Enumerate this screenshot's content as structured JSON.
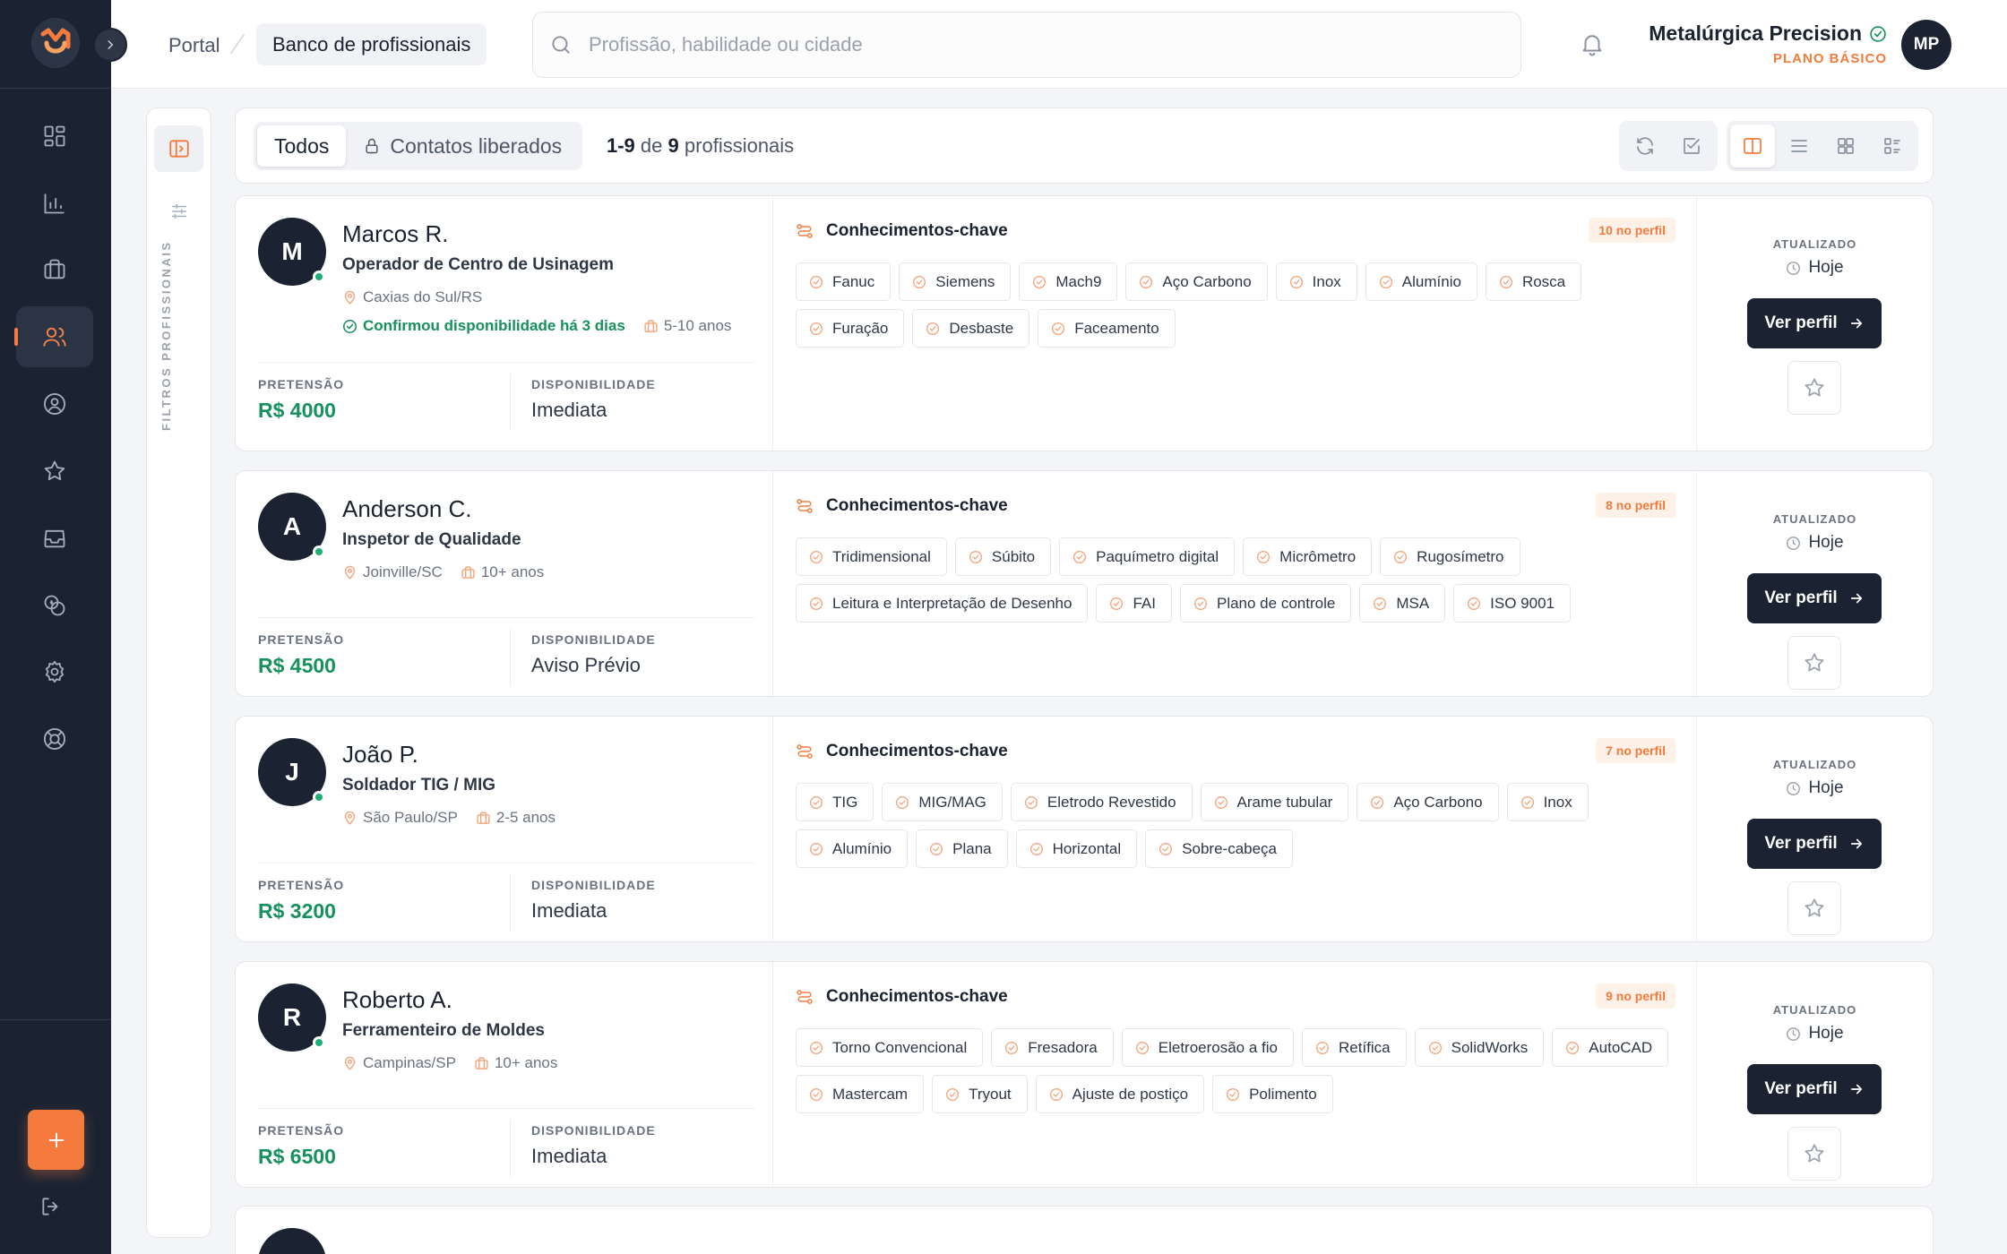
{
  "header": {
    "breadcrumb_root": "Portal",
    "breadcrumb_current": "Banco de profissionais",
    "search_placeholder": "Profissão, habilidade ou cidade",
    "company_name": "Metalúrgica Precision",
    "company_plan": "PLANO BÁSICO",
    "avatar_initials": "MP"
  },
  "filters": {
    "label": "FILTROS PROFISSIONAIS"
  },
  "toolbar": {
    "tab_all": "Todos",
    "tab_unlocked": "Contatos liberados",
    "count_range": "1-9",
    "count_of": "de",
    "count_total": "9",
    "count_suffix": "profissionais"
  },
  "labels": {
    "key_knowledge": "Conhecimentos-chave",
    "salary": "PRETENSÃO",
    "availability": "DISPONIBILIDADE",
    "updated": "ATUALIZADO",
    "view_profile": "Ver perfil"
  },
  "professionals": [
    {
      "initial": "M",
      "name": "Marcos R.",
      "role": "Operador de Centro de Usinagem",
      "city": "Caxias do Sul/RS",
      "availability_confirmed": "Confirmou disponibilidade há 3 dias",
      "experience": "5-10 anos",
      "salary": "R$ 4000",
      "availability": "Imediata",
      "skills_count": "10 no perfil",
      "updated": "Hoje",
      "skills": [
        "Fanuc",
        "Siemens",
        "Mach9",
        "Aço Carbono",
        "Inox",
        "Alumínio",
        "Rosca",
        "Furação",
        "Desbaste",
        "Faceamento"
      ]
    },
    {
      "initial": "A",
      "name": "Anderson C.",
      "role": "Inspetor de Qualidade",
      "city": "Joinville/SC",
      "experience": "10+ anos",
      "salary": "R$ 4500",
      "availability": "Aviso Prévio",
      "skills_count": "8 no perfil",
      "updated": "Hoje",
      "skills": [
        "Tridimensional",
        "Súbito",
        "Paquímetro digital",
        "Micrômetro",
        "Rugosímetro",
        "Leitura e Interpretação de Desenho",
        "FAI",
        "Plano de controle",
        "MSA",
        "ISO 9001"
      ]
    },
    {
      "initial": "J",
      "name": "João P.",
      "role": "Soldador TIG / MIG",
      "city": "São Paulo/SP",
      "experience": "2-5 anos",
      "salary": "R$ 3200",
      "availability": "Imediata",
      "skills_count": "7 no perfil",
      "updated": "Hoje",
      "skills": [
        "TIG",
        "MIG/MAG",
        "Eletrodo Revestido",
        "Arame tubular",
        "Aço Carbono",
        "Inox",
        "Alumínio",
        "Plana",
        "Horizontal",
        "Sobre-cabeça"
      ]
    },
    {
      "initial": "R",
      "name": "Roberto A.",
      "role": "Ferramenteiro de Moldes",
      "city": "Campinas/SP",
      "experience": "10+ anos",
      "salary": "R$ 6500",
      "availability": "Imediata",
      "skills_count": "9 no perfil",
      "updated": "Hoje",
      "skills": [
        "Torno Convencional",
        "Fresadora",
        "Eletroerosão a fio",
        "Retífica",
        "SolidWorks",
        "AutoCAD",
        "Mastercam",
        "Tryout",
        "Ajuste de postiço",
        "Polimento"
      ]
    }
  ],
  "colors": {
    "accent": "#f47b3d",
    "sidebar": "#1b2332",
    "success": "#16915d"
  }
}
